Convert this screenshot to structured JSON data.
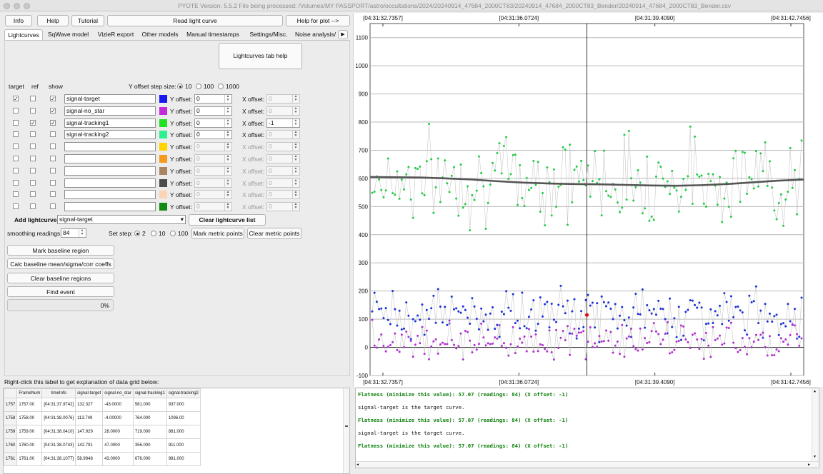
{
  "window": {
    "title": "PYOTE Version: 5.5.2  File being processed: /Volumes/MY PASSPORT/astro/occultations/2024/20240914_47684_2000CT83/20240914_47684_2000CT83_Bender/20240914_47684_2000CT83_Bender.csv"
  },
  "toolbar": {
    "info": "Info",
    "help": "Help",
    "tutorial": "Tutorial",
    "read_light_curve": "Read light curve",
    "help_for_plot": "Help for plot -->"
  },
  "tabs": [
    "Lightcurves",
    "SqWave model",
    "VizieR export",
    "Other models",
    "Manual timestamps",
    "Settings/Misc.",
    "Noise analysis/"
  ],
  "lightcurves": {
    "help_button": "Lightcurves tab help",
    "col_target": "target",
    "col_ref": "ref",
    "col_show": "show",
    "yoffset_step_label": "Y offset step size:",
    "yoffset_steps": [
      "10",
      "100",
      "1000"
    ],
    "yoffset_label": "Y offset:",
    "xoffset_label": "X offset:",
    "rows": [
      {
        "name": "signal-target",
        "target": "✓",
        "ref": "",
        "show": "✓",
        "color": "#1a1aee",
        "yoff": "0",
        "xoff": "0",
        "enabled": true
      },
      {
        "name": "signal-no_star",
        "target": "",
        "ref": "",
        "show": "✓",
        "color": "#c12bdc",
        "yoff": "0",
        "xoff": "0",
        "enabled": true
      },
      {
        "name": "signal-tracking1",
        "target": "",
        "ref": "✓",
        "show": "✓",
        "color": "#22e022",
        "yoff": "0",
        "xoff": "-1",
        "enabled": true
      },
      {
        "name": "signal-tracking2",
        "target": "",
        "ref": "",
        "show": "",
        "color": "#2df08f",
        "yoff": "0",
        "xoff": "0",
        "enabled": true
      },
      {
        "name": "",
        "target": "",
        "ref": "",
        "show": "",
        "color": "#ffd400",
        "yoff": "0",
        "xoff": "0",
        "enabled": false
      },
      {
        "name": "",
        "target": "",
        "ref": "",
        "show": "",
        "color": "#f59a1d",
        "yoff": "0",
        "xoff": "0",
        "enabled": false
      },
      {
        "name": "",
        "target": "",
        "ref": "",
        "show": "",
        "color": "#a98563",
        "yoff": "0",
        "xoff": "0",
        "enabled": false
      },
      {
        "name": "",
        "target": "",
        "ref": "",
        "show": "",
        "color": "#4c4c4c",
        "yoff": "0",
        "xoff": "0",
        "enabled": false
      },
      {
        "name": "",
        "target": "",
        "ref": "",
        "show": "",
        "color": "#fcd4b4",
        "yoff": "0",
        "xoff": "0",
        "enabled": false
      },
      {
        "name": "",
        "target": "",
        "ref": "",
        "show": "",
        "color": "#128a12",
        "yoff": "0",
        "xoff": "0",
        "enabled": false
      }
    ],
    "add_lightcurve_label": "Add lightcurve",
    "add_lightcurve_value": "signal-target",
    "clear_list": "Clear lightcurve list",
    "smoothing_label": "smoothing readings",
    "smoothing_value": "84",
    "set_step_label": "Set step:",
    "set_steps": [
      "2",
      "10",
      "100"
    ],
    "mark_metric": "Mark metric points",
    "clear_metric": "Clear metric points",
    "mark_baseline": "Mark baseline region",
    "calc_baseline": "Calc baseline mean/sigma/corr coeffs",
    "clear_baseline": "Clear baseline regions",
    "find_event": "Find event",
    "progress": "0%",
    "progress_fraction": 0
  },
  "grid": {
    "label": "Right-click this label to get explanation of data grid below:",
    "headers": [
      "FrameNum",
      "timeInfo",
      "signal-target",
      "signal-no_star",
      "signal-tracking1",
      "signal-tracking2"
    ],
    "rows": [
      [
        "1757",
        "1757.00",
        "[04:31:37.9742]",
        "132.327",
        "-43.0000",
        "581.000",
        "937.000"
      ],
      [
        "1758",
        "1758.00",
        "[04:31:38.0076]",
        "113.749",
        "-4.00000",
        "764.000",
        "1096.00"
      ],
      [
        "1759",
        "1759.00",
        "[04:31:38.0410]",
        "147.929",
        "28.0000",
        "719.000",
        "881.000"
      ],
      [
        "1760",
        "1760.00",
        "[04:31:38.0743]",
        "142.791",
        "47.0000",
        "356.000",
        "911.000"
      ],
      [
        "1761",
        "1761.00",
        "[04:31:38.1077]",
        "58.9948",
        "43.0000",
        "676.000",
        "981.000"
      ]
    ]
  },
  "log": {
    "lines": [
      {
        "text": "Flatness (minimize this value): 57.07 (readings: 84) (X offset: -1)",
        "style": "g"
      },
      {
        "text": "signal-target is the target curve.",
        "style": ""
      },
      {
        "text": "Flatness (minimize this value): 57.07 (readings: 84) (X offset: -1)",
        "style": "g"
      },
      {
        "text": "signal-target is the target curve.",
        "style": ""
      },
      {
        "text": "Flatness (minimize this value): 57.07 (readings: 84) (X offset: -1)",
        "style": "g"
      }
    ]
  },
  "chart_data": {
    "type": "scatter",
    "time_ticks": [
      "[04:31:32.7357]",
      "[04:31:36.0724]",
      "[04:31:39.4090]",
      "[04:31:42.7456]"
    ],
    "y_ticks": [
      "-100",
      "0",
      "100",
      "200",
      "300",
      "400",
      "500",
      "600",
      "700",
      "800",
      "900",
      "1000",
      "1100"
    ],
    "ylim": [
      -100,
      1150
    ],
    "cursor_at_reading": 0.5,
    "series": [
      {
        "name": "signal-tracking1",
        "color": "#22cc44",
        "mean": 600,
        "spread": 110,
        "min": 290,
        "max": 900
      },
      {
        "name": "signal-target",
        "color": "#1a2fd6",
        "mean": 120,
        "spread": 60,
        "min": -60,
        "max": 300
      },
      {
        "name": "signal-no_star",
        "color": "#b030d0",
        "mean": 25,
        "spread": 45,
        "min": -90,
        "max": 150
      },
      {
        "name": "smoothed",
        "color": "#555555",
        "values": [
          605,
          604,
          603,
          600,
          596,
          590,
          585,
          582,
          580,
          579,
          577,
          575,
          574,
          576,
          580,
          586,
          592,
          596
        ]
      }
    ],
    "marker": {
      "value": 115,
      "color": "#dd1111"
    }
  }
}
